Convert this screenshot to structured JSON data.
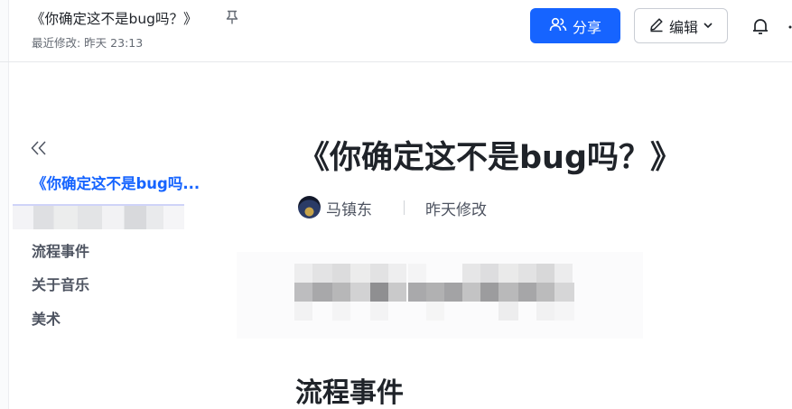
{
  "header": {
    "doc_title": "《你确定这不是bug吗？》",
    "last_modified": "最近修改: 昨天 23:13",
    "share_label": "分享",
    "edit_label": "编辑"
  },
  "sidebar": {
    "toc": [
      {
        "label": "《你确定这不是bug吗...",
        "active": true
      },
      {
        "label": "流程事件"
      },
      {
        "label": "关于音乐"
      },
      {
        "label": "美术"
      }
    ]
  },
  "main": {
    "title": "《你确定这不是bug吗？》",
    "author": "马镇东",
    "modified": "昨天修改",
    "section_heading": "流程事件"
  },
  "colors": {
    "accent": "#1664ff",
    "text": "#1f2329",
    "muted": "#646a73"
  },
  "icons": [
    "pin-icon",
    "share-users-icon",
    "pencil-icon",
    "chevron-down-icon",
    "bell-icon",
    "more-icon",
    "collapse-double-chevron-icon",
    "avatar"
  ]
}
